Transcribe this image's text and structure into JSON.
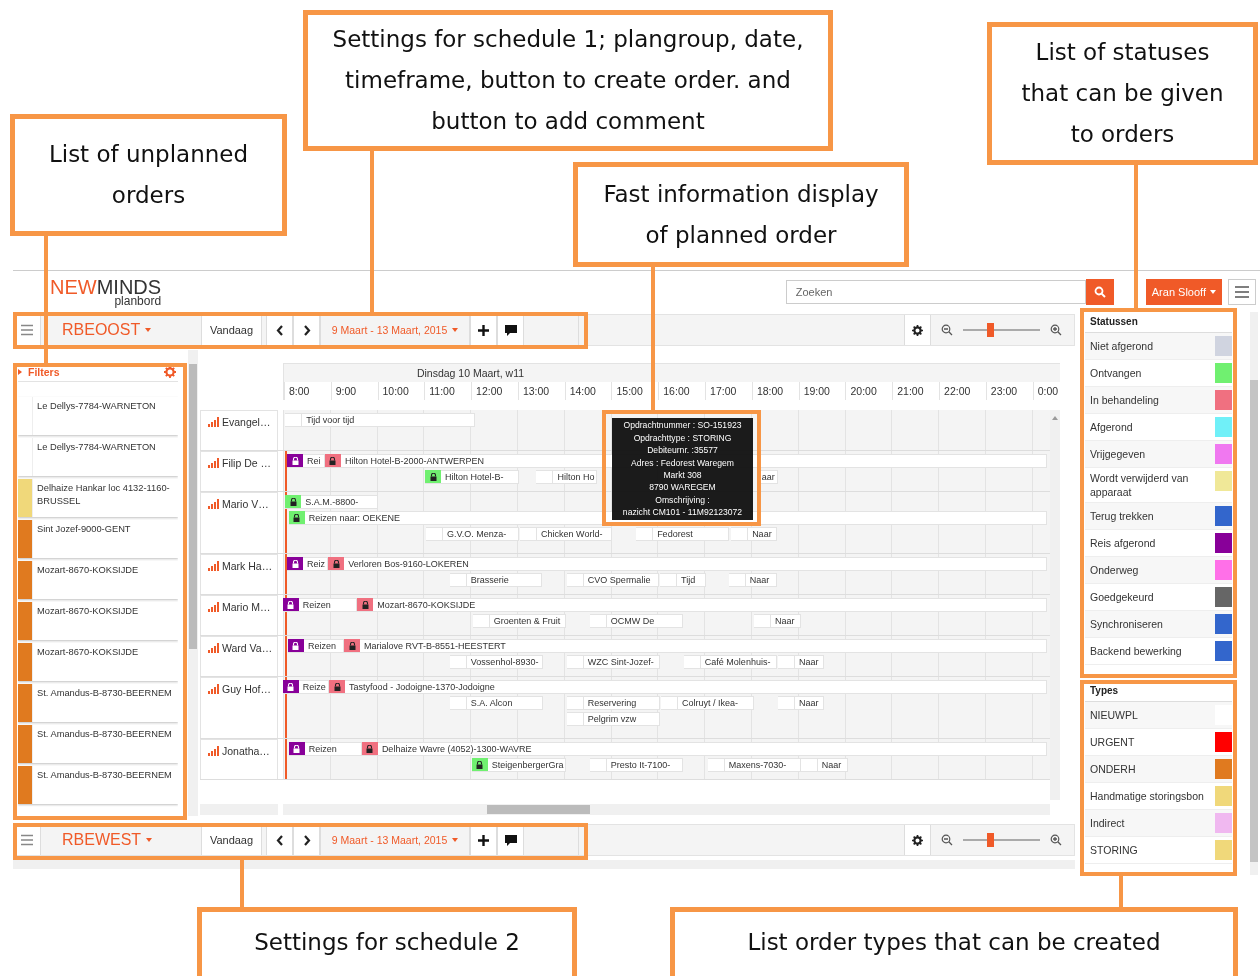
{
  "callouts": [
    {
      "text": "List of unplanned orders"
    },
    {
      "text": "Settings for schedule 1; plangroup, date, timeframe, button to create order. and button to add comment"
    },
    {
      "text": "Fast information display of planned order"
    },
    {
      "text": "List of statuses that can be given to orders"
    },
    {
      "text": "Settings for schedule 2"
    },
    {
      "text": "List order types that can be created"
    }
  ],
  "header": {
    "logo_part_1": "NEW",
    "logo_part_2": "MINDS",
    "logo_subtitle": "planbord",
    "search": {
      "placeholder": "Zoeken"
    },
    "user": "Aran Slooff"
  },
  "schedules": [
    {
      "group": "RBEOOST",
      "today": "Vandaag",
      "date_range": "9 Maart - 13 Maart, 2015",
      "zoom": {
        "level": 0.35
      }
    },
    {
      "group": "RBEWEST",
      "today": "Vandaag",
      "date_range": "9 Maart - 13 Maart, 2015",
      "zoom": {
        "level": 0.35
      }
    }
  ],
  "filters": {
    "title": "Filters"
  },
  "unplanned": [
    {
      "text": "Le Dellys-7784-WARNETON",
      "color": "#ffffff"
    },
    {
      "text": "Le Dellys-7784-WARNETON",
      "color": "#ffffff"
    },
    {
      "text": "Delhaize Hankar loc 4132-1160-BRUSSEL",
      "color": "#f0d87a"
    },
    {
      "text": "Sint Jozef-9000-GENT",
      "color": "#e07a1f"
    },
    {
      "text": "Mozart-8670-KOKSIJDE",
      "color": "#e07a1f"
    },
    {
      "text": "Mozart-8670-KOKSIJDE",
      "color": "#e07a1f"
    },
    {
      "text": "Mozart-8670-KOKSIJDE",
      "color": "#e07a1f"
    },
    {
      "text": "St. Amandus-B-8730-BEERNEM",
      "color": "#e07a1f"
    },
    {
      "text": "St. Amandus-B-8730-BEERNEM",
      "color": "#e07a1f"
    },
    {
      "text": "St. Amandus-B-8730-BEERNEM",
      "color": "#e07a1f"
    }
  ],
  "gantt": {
    "day": "Dinsdag 10 Maart, w11",
    "hours": [
      "8:00",
      "9:00",
      "10:00",
      "11:00",
      "12:00",
      "13:00",
      "14:00",
      "15:00",
      "16:00",
      "17:00",
      "18:00",
      "19:00",
      "20:00",
      "21:00",
      "22:00",
      "23:00",
      "0:00"
    ],
    "rows": [
      {
        "name": "Evangel…",
        "bars": [
          {
            "label": "Tijd voor tijd"
          }
        ]
      },
      {
        "name": "Filip De …",
        "bars": [
          {
            "label": "Rei",
            "color": "#880099",
            "locked": true
          },
          {
            "label": "Hilton Hotel-B-2000-ANTWERPEN",
            "color": "#f07080",
            "locked": true
          },
          {
            "label": "Hilton Hotel-B-",
            "color": "#70f070",
            "locked": true
          },
          {
            "label": "Hilton Ho"
          },
          {
            "label": "aar"
          }
        ]
      },
      {
        "name": "Mario V…",
        "bars": [
          {
            "label": "S.A.M.-8800-",
            "color": "#70f070",
            "locked": true
          },
          {
            "label": "Reizen naar: OEKENE",
            "color": "#70f070",
            "locked": true
          },
          {
            "label": "G.V.O. Menza-"
          },
          {
            "label": "Chicken World-"
          },
          {
            "label": "Fedorest"
          },
          {
            "label": "Naar"
          }
        ]
      },
      {
        "name": "Mark Ha…",
        "bars": [
          {
            "label": "Reiz",
            "color": "#880099",
            "locked": true
          },
          {
            "label": "Verloren Bos-9160-LOKEREN",
            "color": "#f07080",
            "locked": true
          },
          {
            "label": "Brasserie"
          },
          {
            "label": "CVO Spermalie"
          },
          {
            "label": "Tijd"
          },
          {
            "label": "Naar"
          }
        ]
      },
      {
        "name": "Mario M…",
        "bars": [
          {
            "label": "Reizen",
            "color": "#880099",
            "locked": true
          },
          {
            "label": "Mozart-8670-KOKSIJDE",
            "color": "#f07080",
            "locked": true
          },
          {
            "label": "Groenten & Fruit"
          },
          {
            "label": "OCMW De"
          },
          {
            "label": "Naar"
          }
        ]
      },
      {
        "name": "Ward Va…",
        "bars": [
          {
            "label": "Reizen",
            "color": "#880099",
            "locked": true
          },
          {
            "label": "Marialove RVT-B-8551-HEESTERT",
            "color": "#f07080",
            "locked": true
          },
          {
            "label": "Vossenhol-8930-"
          },
          {
            "label": "WZC Sint-Jozef-"
          },
          {
            "label": "Café Molenhuis-"
          },
          {
            "label": "Naar"
          }
        ]
      },
      {
        "name": "Guy Hof…",
        "bars": [
          {
            "label": "Reize",
            "color": "#880099",
            "locked": true
          },
          {
            "label": "Tastyfood - Jodoigne-1370-Jodoigne",
            "color": "#f07080",
            "locked": true
          },
          {
            "label": "S.A. Alcon"
          },
          {
            "label": "Reservering"
          },
          {
            "label": "Colruyt / Ikea-"
          },
          {
            "label": "Naar"
          },
          {
            "label": "Pelgrim vzw"
          }
        ]
      },
      {
        "name": "Jonatha…",
        "bars": [
          {
            "label": "Reizen",
            "color": "#880099",
            "locked": true
          },
          {
            "label": "Delhaize Wavre (4052)-1300-WAVRE",
            "color": "#f07080",
            "locked": true
          },
          {
            "label": "SteigenbergerGra",
            "color": "#70f070",
            "locked": true
          },
          {
            "label": "Presto It-7100-"
          },
          {
            "label": "Maxens-7030-"
          },
          {
            "label": "Naar"
          }
        ]
      }
    ]
  },
  "tooltip": {
    "lines": [
      "Opdrachtnummer : SO-151923",
      "Opdrachttype : STORING",
      "Debiteurnr. :35577",
      "Adres : Fedorest Waregem",
      "Markt 308",
      "8790 WAREGEM",
      "Omschrijving :",
      "nazicht CM101 - 11M92123072"
    ]
  },
  "statuses": {
    "title": "Statussen",
    "items": [
      {
        "label": "Niet afgerond",
        "color": "#d0d4e0"
      },
      {
        "label": "Ontvangen",
        "color": "#70f070"
      },
      {
        "label": "In behandeling",
        "color": "#f07080"
      },
      {
        "label": "Afgerond",
        "color": "#70f0f8"
      },
      {
        "label": "Vrijgegeven",
        "color": "#f078f0"
      },
      {
        "label": "Wordt verwijderd van apparaat",
        "color": "#f0e898"
      },
      {
        "label": "Terug trekken",
        "color": "#3366cc"
      },
      {
        "label": "Reis afgerond",
        "color": "#880099"
      },
      {
        "label": "Onderweg",
        "color": "#ff70e8"
      },
      {
        "label": "Goedgekeurd",
        "color": "#666666"
      },
      {
        "label": "Synchroniseren",
        "color": "#3366cc"
      },
      {
        "label": "Backend bewerking",
        "color": "#3366cc"
      }
    ]
  },
  "types": {
    "title": "Types",
    "items": [
      {
        "label": "NIEUWPL",
        "color": "#ffffff"
      },
      {
        "label": "URGENT",
        "color": "#ff0000"
      },
      {
        "label": "ONDERH",
        "color": "#e07a1f"
      },
      {
        "label": "Handmatige storingsbon",
        "color": "#f0d87a"
      },
      {
        "label": "Indirect",
        "color": "#f0b8f0"
      },
      {
        "label": "STORING",
        "color": "#f0d87a"
      }
    ]
  }
}
